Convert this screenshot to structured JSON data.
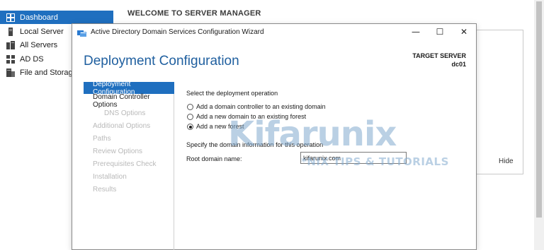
{
  "server_manager": {
    "sidebar": {
      "items": [
        {
          "label": "Dashboard",
          "icon": "dashboard-icon",
          "active": true
        },
        {
          "label": "Local Server",
          "icon": "server-icon"
        },
        {
          "label": "All Servers",
          "icon": "servers-icon"
        },
        {
          "label": "AD DS",
          "icon": "ad-ds-icon"
        },
        {
          "label": "File and Storage",
          "icon": "file-storage-icon"
        }
      ]
    },
    "welcome_title": "WELCOME TO SERVER MANAGER",
    "hide_label": "Hide"
  },
  "wizard": {
    "title": "Active Directory Domain Services Configuration Wizard",
    "controls": {
      "minimize": "—",
      "maximize": "☐",
      "close": "✕"
    },
    "heading": "Deployment Configuration",
    "target_server_label": "TARGET SERVER",
    "target_server_value": "dc01",
    "nav": [
      {
        "label": "Deployment Configuration",
        "state": "active"
      },
      {
        "label": "Domain Controller Options",
        "state": "normal"
      },
      {
        "label": "DNS Options",
        "state": "dim"
      },
      {
        "label": "Additional Options",
        "state": "dim"
      },
      {
        "label": "Paths",
        "state": "dim"
      },
      {
        "label": "Review Options",
        "state": "dim"
      },
      {
        "label": "Prerequisites Check",
        "state": "dim"
      },
      {
        "label": "Installation",
        "state": "dim"
      },
      {
        "label": "Results",
        "state": "dim"
      }
    ],
    "operation_prompt": "Select the deployment operation",
    "operations": [
      {
        "label": "Add a domain controller to an existing domain",
        "checked": false
      },
      {
        "label": "Add a new domain to an existing forest",
        "checked": false
      },
      {
        "label": "Add a new forest",
        "checked": true
      }
    ],
    "domain_info_prompt": "Specify the domain information for this operation",
    "root_domain_label": "Root domain name:",
    "root_domain_value": "kifarunix.com"
  },
  "watermark": {
    "name": "Kifarunix",
    "tagline": "*NIX TIPS & TUTORIALS"
  },
  "colors": {
    "accent": "#1f6fbf",
    "heading": "#1f5f9f"
  }
}
